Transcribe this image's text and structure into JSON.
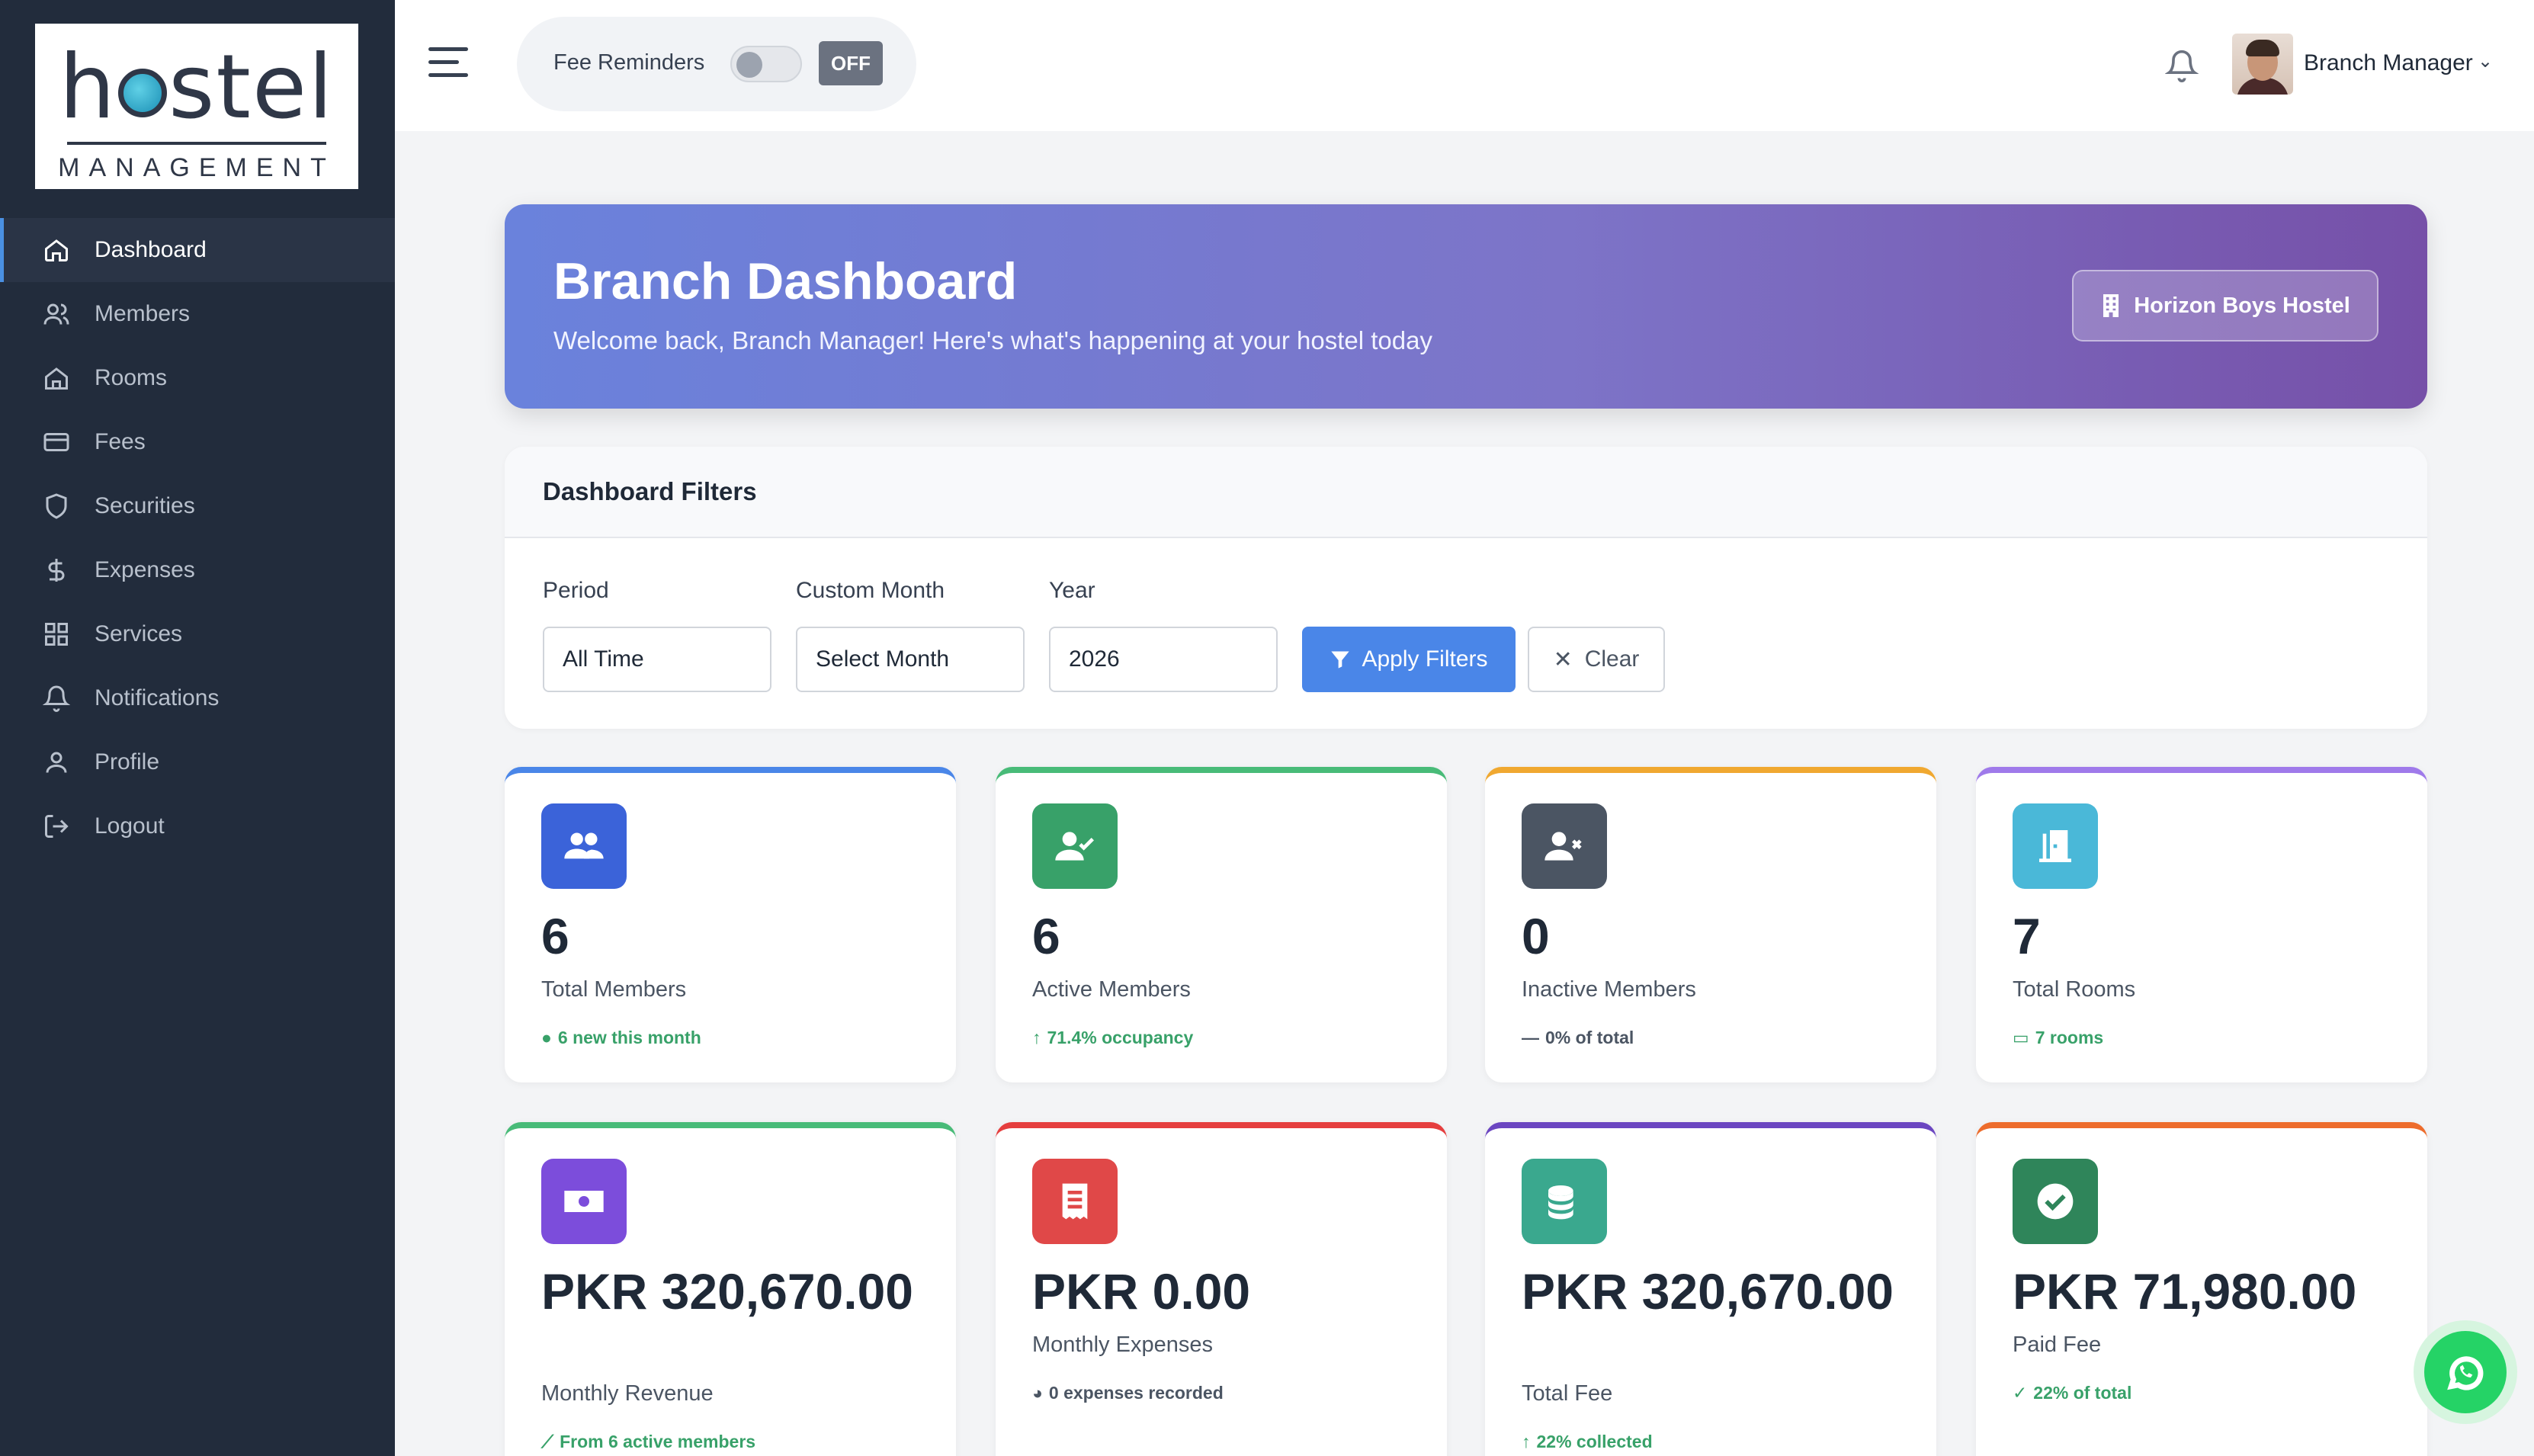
{
  "brand": {
    "logo_main": "hostel",
    "logo_sub": "MANAGEMENT"
  },
  "sidebar": {
    "items": [
      {
        "label": "Dashboard",
        "icon": "home-icon",
        "active": true
      },
      {
        "label": "Members",
        "icon": "users-icon"
      },
      {
        "label": "Rooms",
        "icon": "building-icon"
      },
      {
        "label": "Fees",
        "icon": "credit-card-icon"
      },
      {
        "label": "Securities",
        "icon": "shield-icon"
      },
      {
        "label": "Expenses",
        "icon": "dollar-icon"
      },
      {
        "label": "Services",
        "icon": "grid-icon"
      },
      {
        "label": "Notifications",
        "icon": "bell-icon"
      },
      {
        "label": "Profile",
        "icon": "user-icon"
      },
      {
        "label": "Logout",
        "icon": "logout-icon"
      }
    ]
  },
  "topbar": {
    "fee_reminders_label": "Fee Reminders",
    "fee_reminders_state": "OFF",
    "user_name": "Branch Manager"
  },
  "hero": {
    "title": "Branch Dashboard",
    "subtitle": "Welcome back, Branch Manager! Here's what's happening at your hostel today",
    "hostel_name": "Horizon Boys Hostel"
  },
  "filters": {
    "title": "Dashboard Filters",
    "period_label": "Period",
    "period_value": "All Time",
    "month_label": "Custom Month",
    "month_value": "Select Month",
    "year_label": "Year",
    "year_value": "2026",
    "apply_label": "Apply Filters",
    "clear_label": "Clear"
  },
  "stats": [
    {
      "value": "6",
      "label": "Total Members",
      "note": "6 new this month",
      "note_icon": "info-icon",
      "accent": "#4a86e8",
      "icon_bg": "#3b63d9",
      "icon": "users-icon"
    },
    {
      "value": "6",
      "label": "Active Members",
      "note": "71.4% occupancy",
      "note_icon": "arrow-up-icon",
      "accent": "#48bb78",
      "icon_bg": "#38a169",
      "icon": "user-check-icon"
    },
    {
      "value": "0",
      "label": "Inactive Members",
      "note": "0% of total",
      "note_icon": "dash-icon",
      "accent": "#f0a830",
      "icon_bg": "#4b5563",
      "icon": "user-x-icon"
    },
    {
      "value": "7",
      "label": "Total Rooms",
      "note": "7 rooms",
      "note_icon": "ticket-icon",
      "accent": "#9f7aea",
      "icon_bg": "#4ab8d8",
      "icon": "door-icon"
    },
    {
      "value": "PKR 320,670.00",
      "label": "Monthly Revenue",
      "note": "From 6 active members",
      "note_icon": "chart-icon",
      "accent": "#48bb78",
      "icon_bg": "#7c4ddb",
      "icon": "money-icon"
    },
    {
      "value": "PKR 0.00",
      "label": "Monthly Expenses",
      "note": "0 expenses recorded",
      "note_icon": "pie-icon",
      "accent": "#e53e3e",
      "icon_bg": "#e04848",
      "icon": "receipt-icon"
    },
    {
      "value": "PKR 320,670.00",
      "label": "Total Fee",
      "note": "22% collected",
      "note_icon": "arrow-up-icon",
      "accent": "#6b46c1",
      "icon_bg": "#3aa88e",
      "icon": "coins-icon"
    },
    {
      "value": "PKR 71,980.00",
      "label": "Paid Fee",
      "note": "22% of total",
      "note_icon": "check-icon",
      "accent": "#ed6c2c",
      "icon_bg": "#2f855a",
      "icon": "check-circle-icon"
    }
  ],
  "colors": {
    "sidebar": "#222c3c",
    "primary": "#4a86e8",
    "positive": "#38a169",
    "neutral_note": "#4b5563"
  }
}
